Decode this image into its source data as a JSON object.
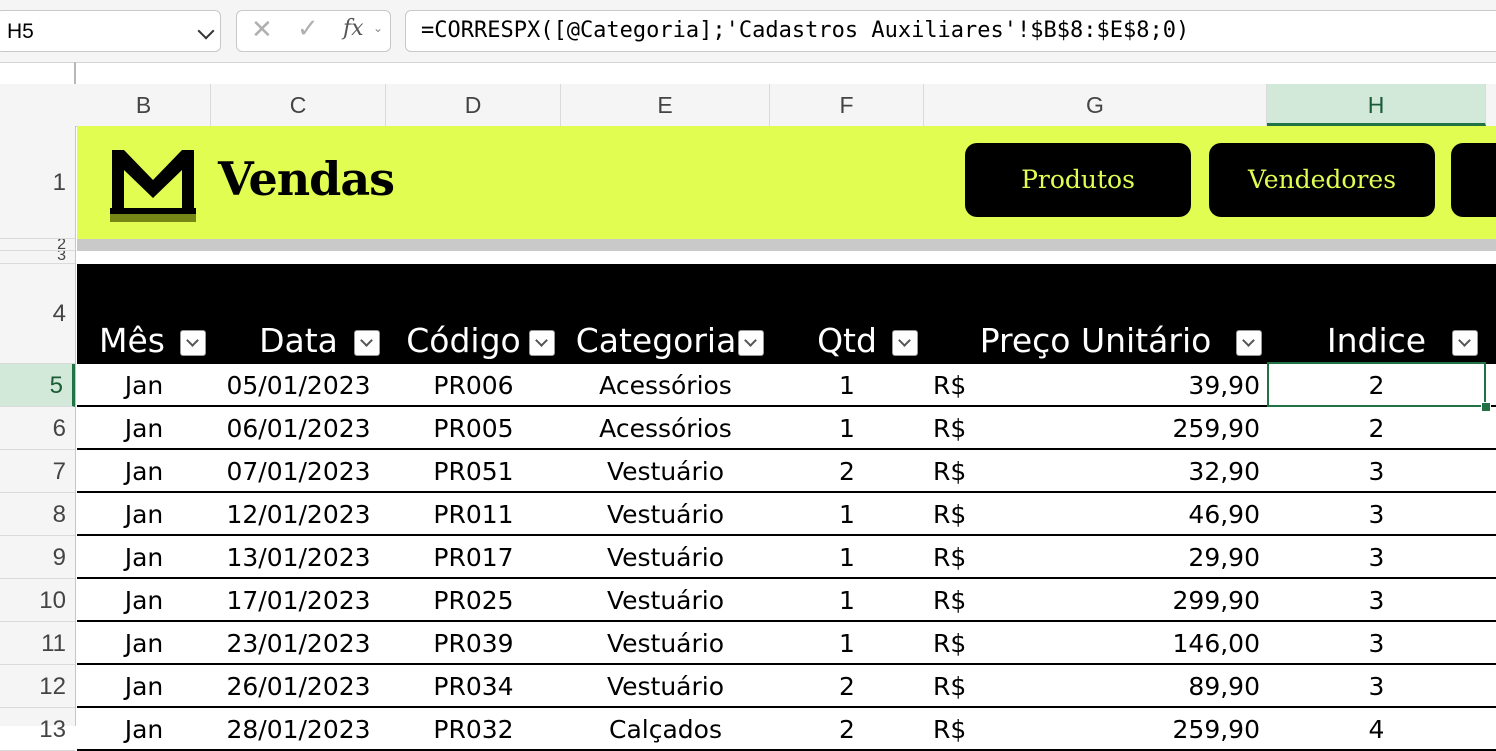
{
  "namebox": "H5",
  "formula": "=CORRESPX([@Categoria];'Cadastros Auxiliares'!$B$8:$E$8;0)",
  "fx_label": "fx",
  "columns": [
    "B",
    "C",
    "D",
    "E",
    "F",
    "G",
    "H"
  ],
  "rows": [
    "1",
    "2",
    "3",
    "4",
    "5",
    "6",
    "7",
    "8",
    "9",
    "10",
    "11",
    "12",
    "13"
  ],
  "banner": {
    "title": "Vendas",
    "buttons": [
      "Produtos",
      "Vendedores"
    ],
    "accent_color": "#e1fd52"
  },
  "table": {
    "headers": [
      "Mês",
      "Data",
      "Código",
      "Categoria",
      "Qtd",
      "Preço Unitário",
      "Indice"
    ],
    "currency": "R$",
    "rows": [
      {
        "mes": "Jan",
        "data": "05/01/2023",
        "codigo": "PR006",
        "categoria": "Acessórios",
        "qtd": "1",
        "preco": "39,90",
        "indice": "2"
      },
      {
        "mes": "Jan",
        "data": "06/01/2023",
        "codigo": "PR005",
        "categoria": "Acessórios",
        "qtd": "1",
        "preco": "259,90",
        "indice": "2"
      },
      {
        "mes": "Jan",
        "data": "07/01/2023",
        "codigo": "PR051",
        "categoria": "Vestuário",
        "qtd": "2",
        "preco": "32,90",
        "indice": "3"
      },
      {
        "mes": "Jan",
        "data": "12/01/2023",
        "codigo": "PR011",
        "categoria": "Vestuário",
        "qtd": "1",
        "preco": "46,90",
        "indice": "3"
      },
      {
        "mes": "Jan",
        "data": "13/01/2023",
        "codigo": "PR017",
        "categoria": "Vestuário",
        "qtd": "1",
        "preco": "29,90",
        "indice": "3"
      },
      {
        "mes": "Jan",
        "data": "17/01/2023",
        "codigo": "PR025",
        "categoria": "Vestuário",
        "qtd": "1",
        "preco": "299,90",
        "indice": "3"
      },
      {
        "mes": "Jan",
        "data": "23/01/2023",
        "codigo": "PR039",
        "categoria": "Vestuário",
        "qtd": "1",
        "preco": "146,00",
        "indice": "3"
      },
      {
        "mes": "Jan",
        "data": "26/01/2023",
        "codigo": "PR034",
        "categoria": "Vestuário",
        "qtd": "2",
        "preco": "89,90",
        "indice": "3"
      },
      {
        "mes": "Jan",
        "data": "28/01/2023",
        "codigo": "PR032",
        "categoria": "Calçados",
        "qtd": "2",
        "preco": "259,90",
        "indice": "4"
      }
    ]
  },
  "selection_color": "#217346"
}
